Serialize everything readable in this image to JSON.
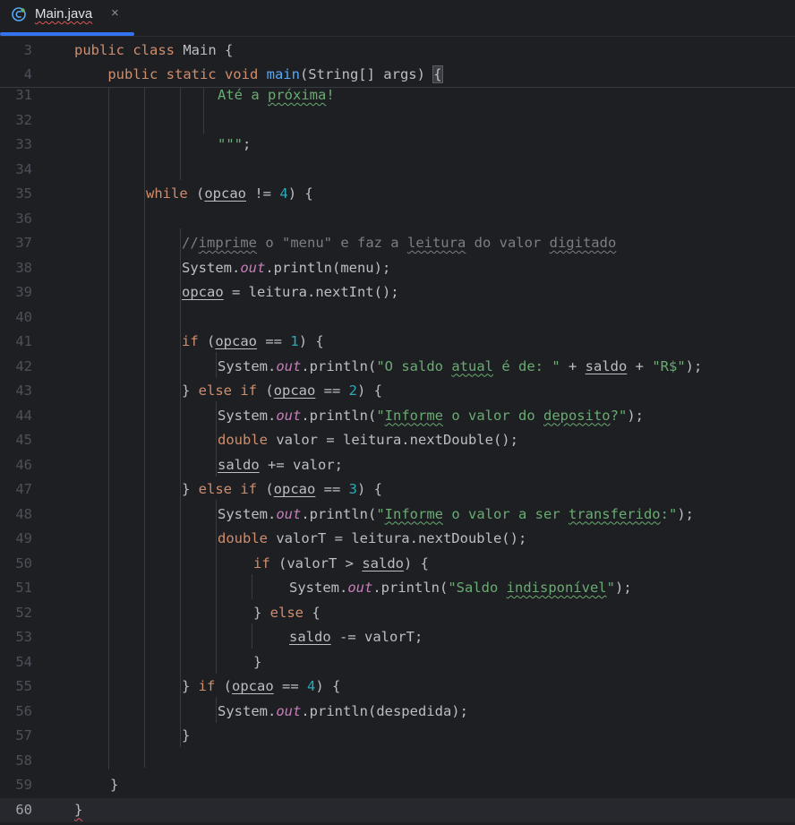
{
  "tab": {
    "label": "Main.java",
    "close": "×",
    "icon": "java-class-icon"
  },
  "sticky": [
    {
      "n": "3",
      "tokens": [
        [
          "kw",
          "public class "
        ],
        [
          "plain",
          "Main {"
        ]
      ]
    },
    {
      "n": "4",
      "tokens": [
        [
          "plain",
          "    "
        ],
        [
          "kw",
          "public static void "
        ],
        [
          "fn",
          "main"
        ],
        [
          "plain",
          "(String[] args) "
        ],
        [
          "hl",
          "{"
        ]
      ]
    }
  ],
  "lines": [
    {
      "n": "31",
      "indent": 16,
      "tokens": [
        [
          "str",
          "Até a "
        ],
        [
          "strtypo",
          "próxima"
        ],
        [
          "str",
          "!"
        ]
      ]
    },
    {
      "n": "32",
      "indent": 0,
      "tokens": []
    },
    {
      "n": "33",
      "indent": 16,
      "tokens": [
        [
          "str",
          "\"\"\""
        ],
        [
          "plain",
          ";"
        ]
      ]
    },
    {
      "n": "34",
      "indent": 0,
      "tokens": []
    },
    {
      "n": "35",
      "indent": 8,
      "tokens": [
        [
          "kw",
          "while "
        ],
        [
          "plain",
          "("
        ],
        [
          "var",
          "opcao"
        ],
        [
          "plain",
          " != "
        ],
        [
          "num",
          "4"
        ],
        [
          "plain",
          ") {"
        ]
      ]
    },
    {
      "n": "36",
      "indent": 0,
      "tokens": []
    },
    {
      "n": "37",
      "indent": 12,
      "tokens": [
        [
          "cm",
          "//"
        ],
        [
          "cmtypo",
          "imprime"
        ],
        [
          "cm",
          " o \"menu\" e faz a "
        ],
        [
          "cmtypo",
          "leitura"
        ],
        [
          "cm",
          " do valor "
        ],
        [
          "cmtypo",
          "digitado"
        ]
      ]
    },
    {
      "n": "38",
      "indent": 12,
      "tokens": [
        [
          "plain",
          "System."
        ],
        [
          "fld",
          "out"
        ],
        [
          "plain",
          ".println(menu);"
        ]
      ]
    },
    {
      "n": "39",
      "indent": 12,
      "tokens": [
        [
          "var",
          "opcao"
        ],
        [
          "plain",
          " = leitura.nextInt();"
        ]
      ]
    },
    {
      "n": "40",
      "indent": 0,
      "tokens": []
    },
    {
      "n": "41",
      "indent": 12,
      "tokens": [
        [
          "kw",
          "if "
        ],
        [
          "plain",
          "("
        ],
        [
          "var",
          "opcao"
        ],
        [
          "plain",
          " == "
        ],
        [
          "num",
          "1"
        ],
        [
          "plain",
          ") {"
        ]
      ]
    },
    {
      "n": "42",
      "indent": 16,
      "tokens": [
        [
          "plain",
          "System."
        ],
        [
          "fld",
          "out"
        ],
        [
          "plain",
          ".println("
        ],
        [
          "str",
          "\"O saldo "
        ],
        [
          "strtypo",
          "atual"
        ],
        [
          "str",
          " é de: \""
        ],
        [
          "plain",
          " + "
        ],
        [
          "var",
          "saldo"
        ],
        [
          "plain",
          " + "
        ],
        [
          "str",
          "\"R$\""
        ],
        [
          "plain",
          ");"
        ]
      ]
    },
    {
      "n": "43",
      "indent": 12,
      "tokens": [
        [
          "plain",
          "} "
        ],
        [
          "kw",
          "else if "
        ],
        [
          "plain",
          "("
        ],
        [
          "var",
          "opcao"
        ],
        [
          "plain",
          " == "
        ],
        [
          "num",
          "2"
        ],
        [
          "plain",
          ") {"
        ]
      ]
    },
    {
      "n": "44",
      "indent": 16,
      "tokens": [
        [
          "plain",
          "System."
        ],
        [
          "fld",
          "out"
        ],
        [
          "plain",
          ".println("
        ],
        [
          "str",
          "\""
        ],
        [
          "strtypo",
          "Informe"
        ],
        [
          "str",
          " o valor do "
        ],
        [
          "strtypo",
          "deposito"
        ],
        [
          "str",
          "?\""
        ],
        [
          "plain",
          ");"
        ]
      ]
    },
    {
      "n": "45",
      "indent": 16,
      "tokens": [
        [
          "kw",
          "double "
        ],
        [
          "plain",
          "valor = leitura.nextDouble();"
        ]
      ]
    },
    {
      "n": "46",
      "indent": 16,
      "tokens": [
        [
          "var",
          "saldo"
        ],
        [
          "plain",
          " += valor;"
        ]
      ]
    },
    {
      "n": "47",
      "indent": 12,
      "tokens": [
        [
          "plain",
          "} "
        ],
        [
          "kw",
          "else if "
        ],
        [
          "plain",
          "("
        ],
        [
          "var",
          "opcao"
        ],
        [
          "plain",
          " == "
        ],
        [
          "num",
          "3"
        ],
        [
          "plain",
          ") {"
        ]
      ]
    },
    {
      "n": "48",
      "indent": 16,
      "tokens": [
        [
          "plain",
          "System."
        ],
        [
          "fld",
          "out"
        ],
        [
          "plain",
          ".println("
        ],
        [
          "str",
          "\""
        ],
        [
          "strtypo",
          "Informe"
        ],
        [
          "str",
          " o valor a ser "
        ],
        [
          "strtypo",
          "transferido"
        ],
        [
          "str",
          ":\""
        ],
        [
          "plain",
          ");"
        ]
      ]
    },
    {
      "n": "49",
      "indent": 16,
      "tokens": [
        [
          "kw",
          "double "
        ],
        [
          "plain",
          "valorT = leitura.nextDouble();"
        ]
      ]
    },
    {
      "n": "50",
      "indent": 20,
      "tokens": [
        [
          "kw",
          "if "
        ],
        [
          "plain",
          "(valorT > "
        ],
        [
          "var",
          "saldo"
        ],
        [
          "plain",
          ") {"
        ]
      ]
    },
    {
      "n": "51",
      "indent": 24,
      "tokens": [
        [
          "plain",
          "System."
        ],
        [
          "fld",
          "out"
        ],
        [
          "plain",
          ".println("
        ],
        [
          "str",
          "\"Saldo "
        ],
        [
          "strtypo",
          "indisponível"
        ],
        [
          "str",
          "\""
        ],
        [
          "plain",
          ");"
        ]
      ]
    },
    {
      "n": "52",
      "indent": 20,
      "tokens": [
        [
          "plain",
          "} "
        ],
        [
          "kw",
          "else "
        ],
        [
          "plain",
          "{"
        ]
      ]
    },
    {
      "n": "53",
      "indent": 24,
      "tokens": [
        [
          "var",
          "saldo"
        ],
        [
          "plain",
          " -= valorT;"
        ]
      ]
    },
    {
      "n": "54",
      "indent": 20,
      "tokens": [
        [
          "plain",
          "}"
        ]
      ]
    },
    {
      "n": "55",
      "indent": 12,
      "tokens": [
        [
          "plain",
          "} "
        ],
        [
          "kw",
          "if "
        ],
        [
          "plain",
          "("
        ],
        [
          "var",
          "opcao"
        ],
        [
          "plain",
          " == "
        ],
        [
          "num",
          "4"
        ],
        [
          "plain",
          ") {"
        ]
      ]
    },
    {
      "n": "56",
      "indent": 16,
      "tokens": [
        [
          "plain",
          "System."
        ],
        [
          "fld",
          "out"
        ],
        [
          "plain",
          ".println(despedida);"
        ]
      ]
    },
    {
      "n": "57",
      "indent": 12,
      "tokens": [
        [
          "plain",
          "}"
        ]
      ]
    },
    {
      "n": "58",
      "indent": 0,
      "tokens": []
    },
    {
      "n": "59",
      "indent": 4,
      "tokens": [
        [
          "plain",
          "}"
        ]
      ]
    },
    {
      "n": "60",
      "indent": 0,
      "tokens": [
        [
          "err",
          "}"
        ]
      ],
      "current": true
    }
  ],
  "colors": {
    "background": "#1e1f22",
    "keyword": "#cf8e6d",
    "string": "#6aab73",
    "number": "#2aacb8",
    "function": "#56a8f5",
    "field": "#c77dbb",
    "comment": "#7a7e85",
    "tab_accent": "#3574f0"
  }
}
